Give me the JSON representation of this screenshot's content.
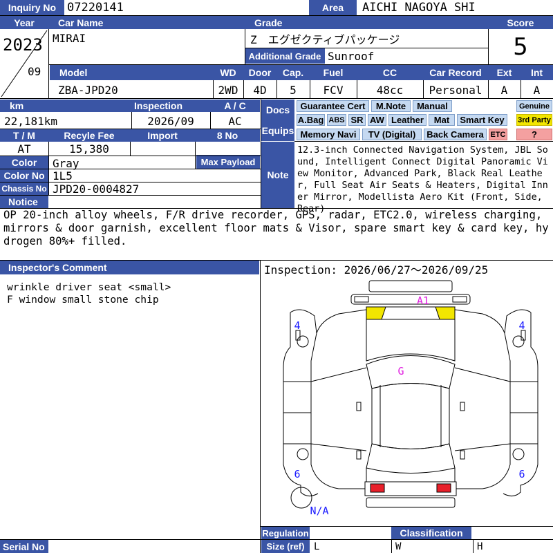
{
  "header": {
    "inquiry_label": "Inquiry No",
    "inquiry_value": "07220141",
    "area_label": "Area",
    "area_value": "AICHI NAGOYA SHI"
  },
  "row1": {
    "year_label": "Year",
    "car_name_label": "Car Name",
    "grade_label": "Grade",
    "score_label": "Score",
    "year_value": "2023",
    "month_value": "09",
    "car_name_value": "MIRAI",
    "grade_value": "Z　エグゼクティブパッケージ",
    "additional_grade_label": "Additional Grade",
    "additional_grade_value": "Sunroof",
    "score_value": "5"
  },
  "model_row": {
    "model_label": "Model",
    "wd_label": "WD",
    "door_label": "Door",
    "cap_label": "Cap.",
    "fuel_label": "Fuel",
    "cc_label": "CC",
    "car_record_label": "Car Record",
    "ext_label": "Ext",
    "int_label": "Int",
    "model_value": "ZBA-JPD20",
    "wd_value": "2WD",
    "door_value": "4D",
    "cap_value": "5",
    "fuel_value": "FCV",
    "cc_value": "48cc",
    "car_record_value": "Personal",
    "ext_value": "A",
    "int_value": "A"
  },
  "details": {
    "km_label": "km",
    "inspection_label": "Inspection",
    "ac_label": "A / C",
    "km_value": "22,181km",
    "inspection_value": "2026/09",
    "ac_value": "AC",
    "tm_label": "T / M",
    "recycle_label": "Recyle Fee",
    "import_label": "Import",
    "eight_label": "8 No",
    "tm_value": "AT",
    "recycle_value": "15,380",
    "color_label": "Color",
    "color_value": "Gray",
    "max_payload_label": "Max Payload",
    "color_no_label": "Color No",
    "color_no_value": "1L5",
    "chassis_label": "Chassis No",
    "chassis_value": "JPD20-0004827",
    "notice_label": "Notice"
  },
  "equips": {
    "docs_label": "Docs",
    "equips_label": "Equips",
    "tags": [
      "Guarantee Cert",
      "M.Note",
      "Manual",
      "A.Bag",
      "ABS",
      "SR",
      "AW",
      "Leather",
      "Mat",
      "Smart Key",
      "Memory Navi",
      "TV (Digital)",
      "Back Camera",
      "ETC"
    ],
    "genuine": "Genuine",
    "third_party": "3rd Party",
    "unknown": "?"
  },
  "note": {
    "label": "Note",
    "text": "12.3-inch Connected Navigation System, JBL Sound, Intelligent Connect Digital Panoramic View Monitor, Advanced Park, Black Real Leather, Full Seat Air Seats & Heaters, Digital Inner Mirror, Modellista Aero Kit (Front, Side, Rear)"
  },
  "notice_text": "OP 20-inch alloy wheels, F/R drive recorder, GPS, radar, ETC2.0, wireless charging, mirrors & door garnish, excellent floor mats & Visor, spare smart key & card key, hydrogen 80%+ filled.",
  "inspector": {
    "label": "Inspector's Comment",
    "text": "wrinkle driver seat <small>\nF window small stone chip"
  },
  "inspection_period": "Inspection: 2026/06/27〜2026/09/25",
  "diagram": {
    "marks": {
      "front": "A1",
      "roof": "G",
      "left_front": "4",
      "right_front": "4",
      "left_rear": "6",
      "right_rear": "6",
      "spare": "N/A"
    },
    "colors": {
      "front_marked": "#f2e600",
      "rear_marked": "#e8202a",
      "mark_text_magenta": "#e020e0",
      "mark_text_blue": "#1a1aff"
    }
  },
  "footer": {
    "serial_label": "Serial No",
    "regulation_label": "Regulation",
    "classification_label": "Classification",
    "size_label": "Size (ref)",
    "l_label": "L",
    "w_label": "W",
    "h_label": "H"
  },
  "colors": {
    "header_bg": "#3a55a5",
    "tag_bg": "#c5d9f1",
    "third_party_bg": "#f2e600",
    "unknown_bg": "#f4a0a0"
  }
}
